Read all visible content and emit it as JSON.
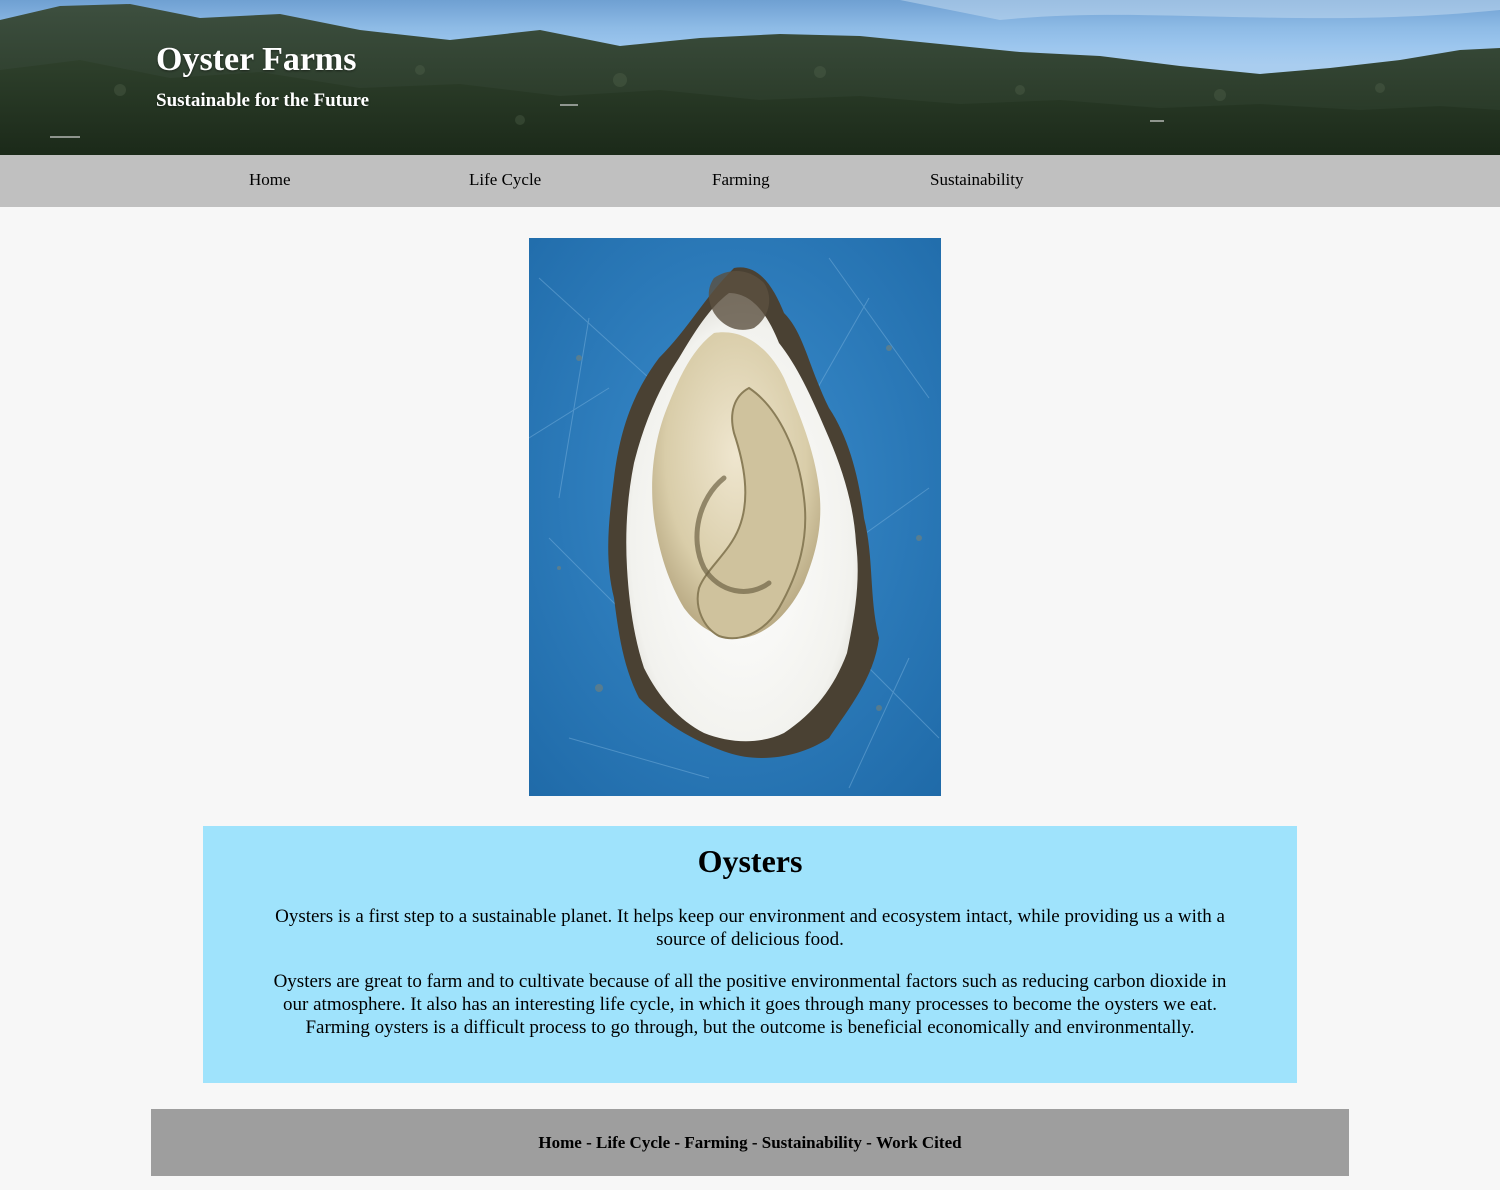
{
  "header": {
    "title": "Oyster Farms",
    "subtitle": "Sustainable for the Future"
  },
  "nav": {
    "items": [
      {
        "label": "Home"
      },
      {
        "label": "Life Cycle"
      },
      {
        "label": "Farming"
      },
      {
        "label": "Sustainability"
      }
    ]
  },
  "main": {
    "image_subject": "opened oyster on blue surface",
    "section_title": "Oysters",
    "paragraphs": [
      "Oysters is a first step to a sustainable planet. It helps keep our environment and ecosystem intact, while providing us a with a source of delicious food.",
      "Oysters are great to farm and to cultivate because of all the positive environmental factors such as reducing carbon dioxide in our atmosphere. It also has an interesting life cycle, in which it goes through many processes to become the oysters we eat. Farming oysters is a difficult process to go through, but the outcome is beneficial economically and environmentally."
    ]
  },
  "footer": {
    "links": [
      "Home",
      "Life Cycle",
      "Farming",
      "Sustainability",
      "Work Cited"
    ],
    "separator": " - "
  },
  "colors": {
    "nav_bg": "#c0c0c0",
    "content_bg": "#9fe3fc",
    "footer_bg": "#9e9e9e",
    "page_bg": "#f7f7f7"
  }
}
